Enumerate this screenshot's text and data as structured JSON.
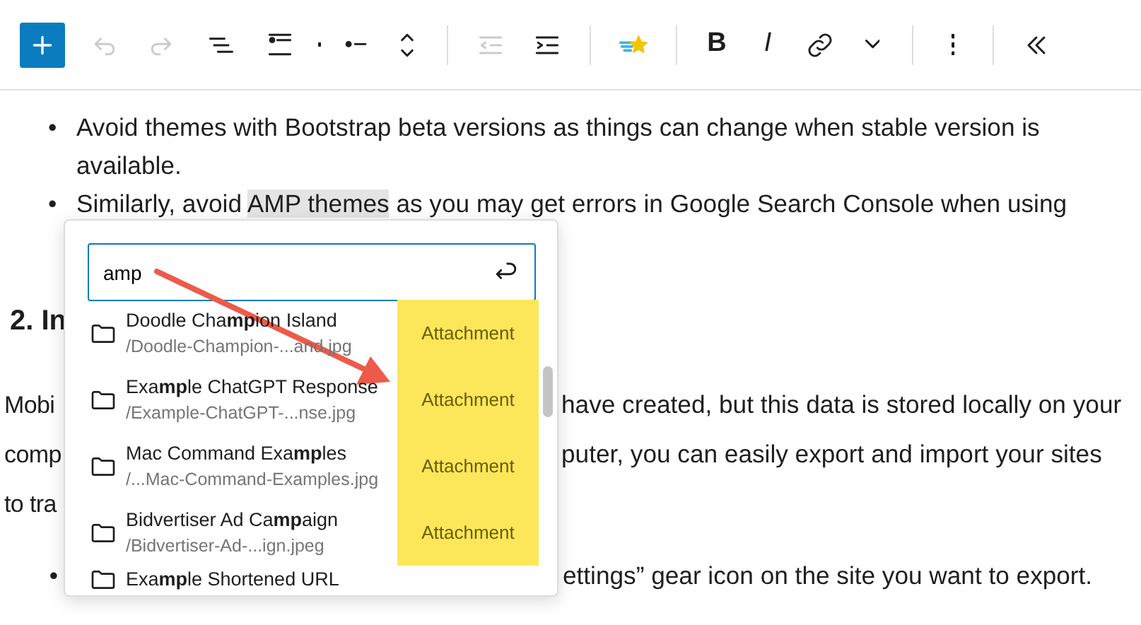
{
  "toolbar": {
    "buttons": [
      {
        "disabled": false
      },
      {
        "disabled": true
      },
      {
        "disabled": true
      },
      {
        "disabled": false
      },
      {
        "disabled": false
      },
      {
        "disabled": false
      },
      {
        "disabled": false
      },
      {
        "disabled": false
      },
      {
        "disabled": true
      },
      {
        "disabled": false
      },
      {
        "disabled": false
      },
      {
        "label": "B",
        "disabled": false
      },
      {
        "label": "I",
        "disabled": false
      },
      {
        "disabled": false
      },
      {
        "disabled": false
      },
      {
        "disabled": false
      },
      {
        "disabled": false
      }
    ]
  },
  "content": {
    "bullets_top": [
      {
        "marker": "•",
        "text": "Avoid themes with Bootstrap beta versions as things can change when stable version is available."
      },
      {
        "marker": "•",
        "text_before": "Similarly, avoid ",
        "highlight": "AMP themes",
        "text_after": " as you may get errors in Google Search Console when using"
      }
    ],
    "heading": "2. In",
    "paragraph_lines": [
      {
        "left": "Mobi",
        "right": "have created, but this data is stored locally on your"
      },
      {
        "left": "comp",
        "right": "puter, you can easily export and import your sites"
      },
      {
        "left": "to tra"
      }
    ],
    "bullets_bottom": [
      {
        "marker": "•",
        "right": "ettings” gear icon on the site you want to export."
      }
    ]
  },
  "link_popup": {
    "search_value": "amp",
    "results": [
      {
        "title": "Doodle Cha**mp**ion Island",
        "path": "/Doodle-Champion-...and.jpg",
        "type": "Attachment",
        "highlighted": true
      },
      {
        "title": "Exa**mp**le ChatGPT Response",
        "path": "/Example-ChatGPT-...nse.jpg",
        "type": "Attachment",
        "highlighted": true
      },
      {
        "title": "Mac Command Exa**mp**les",
        "path": "/...Mac-Command-Examples.jpg",
        "type": "Attachment",
        "highlighted": true
      },
      {
        "title": "Bidvertiser Ad Ca**mp**aign",
        "path": "/Bidvertiser-Ad-...ign.jpeg",
        "type": "Attachment",
        "highlighted": true
      },
      {
        "title": "Exa**mp**le Shortened URL",
        "highlighted": false
      }
    ]
  }
}
